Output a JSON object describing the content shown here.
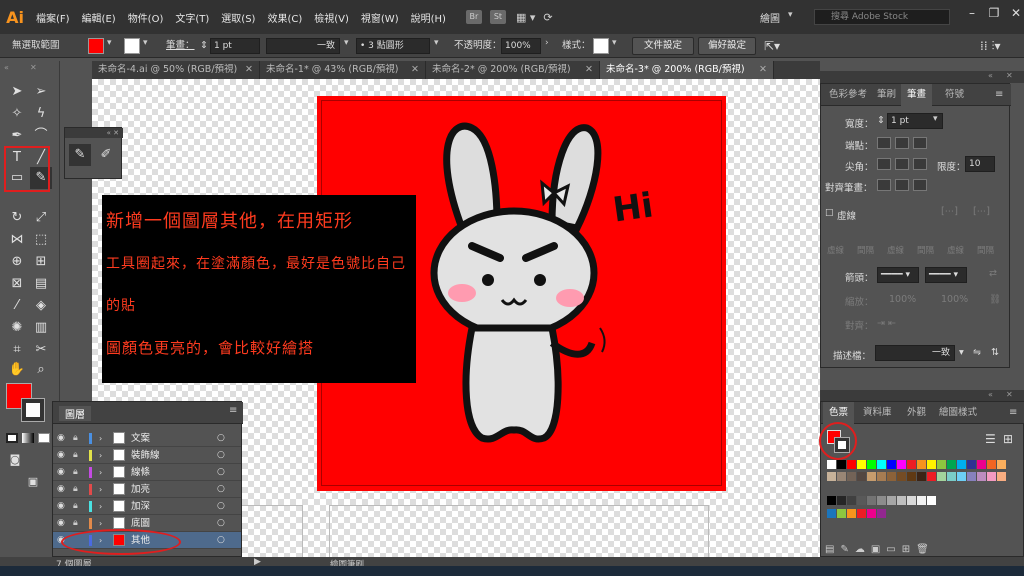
{
  "app": {
    "logo": "Ai",
    "menu": [
      "檔案(F)",
      "編輯(E)",
      "物件(O)",
      "文字(T)",
      "選取(S)",
      "效果(C)",
      "檢視(V)",
      "視窗(W)",
      "說明(H)"
    ],
    "badges": [
      "Br",
      "St"
    ],
    "workspace": "繪圖",
    "stock_search_placeholder": "搜尋 Adobe Stock"
  },
  "control": {
    "selection": "無選取範圍",
    "fill_color": "#ff0000",
    "stroke_label": "筆畫：",
    "stroke_weight": "1 pt",
    "stroke_style": "一致",
    "brush": "3 點圓形",
    "opacity_label": "不透明度：",
    "opacity": "100%",
    "style_label": "樣式：",
    "doc_settings": "文件設定",
    "preferences": "偏好設定"
  },
  "tabs": [
    {
      "label": "未命名-4.ai @ 50% (RGB/預視)",
      "active": false
    },
    {
      "label": "未命名-1* @ 43% (RGB/預視)",
      "active": false
    },
    {
      "label": "未命名-2* @ 200% (RGB/預視)",
      "active": false
    },
    {
      "label": "未命名-3* @ 200% (RGB/預視)",
      "active": true
    }
  ],
  "canvas": {
    "annotation_lines": [
      "新增一個圖層其他，在用矩形",
      "工具圈起來，在塗滿顏色，最好是色號比自己的貼",
      "圖顏色更亮的，會比較好繪搭"
    ],
    "artwork_text": "Hi",
    "artboard_color": "#ff0000"
  },
  "layers": {
    "title": "圖層",
    "count_label": "7 個圖層",
    "rows": [
      {
        "name": "文案",
        "color": "#4a90e2",
        "selected": false
      },
      {
        "name": "裝飾線",
        "color": "#e2e24a",
        "selected": false
      },
      {
        "name": "線條",
        "color": "#c44ae2",
        "selected": false
      },
      {
        "name": "加亮",
        "color": "#e24a4a",
        "selected": false
      },
      {
        "name": "加深",
        "color": "#4ae2e2",
        "selected": false
      },
      {
        "name": "底圖",
        "color": "#e28a4a",
        "selected": false
      },
      {
        "name": "其他",
        "color": "#4a6ae2",
        "selected": true
      }
    ]
  },
  "stroke_panel": {
    "tabs": [
      "色彩參考",
      "筆刷",
      "筆畫",
      "符號"
    ],
    "weight_label": "寬度：",
    "weight": "1 pt",
    "cap_label": "端點：",
    "corner_label": "尖角：",
    "limit_label": "限度：",
    "limit": "10",
    "align_label": "對齊筆畫：",
    "dashed_label": "虛線",
    "dash_labels": [
      "虛線",
      "間隔",
      "虛線",
      "間隔",
      "虛線",
      "間隔"
    ],
    "arrow_label": "箭頭：",
    "scale_label": "縮放：",
    "scale_a": "100%",
    "scale_b": "100%",
    "align_arrow_label": "對齊：",
    "profile_label": "描述檔：",
    "profile": "一致"
  },
  "swatch_panel": {
    "tabs": [
      "色票",
      "資料庫",
      "外觀",
      "繪圖樣式"
    ],
    "colors_row1": [
      "#ffffff",
      "#000000",
      "#ff0000",
      "#ffff00",
      "#00ff00",
      "#00ffff",
      "#0000ff",
      "#ff00ff",
      "#ed1c24",
      "#f7941d",
      "#fff200",
      "#8dc63f",
      "#00a651",
      "#00aeef",
      "#2e3192",
      "#ec008c",
      "#f26522",
      "#fbaf5d"
    ],
    "colors_row2": [
      "#c7b299",
      "#998675",
      "#736357",
      "#534741",
      "#c69c6d",
      "#a67c52",
      "#8c6239",
      "#754c24",
      "#603913",
      "#3c2415",
      "#ee1d24",
      "#a3d39c",
      "#7accc8",
      "#6dcff6",
      "#8781bd",
      "#bd8cbf",
      "#f49ac1",
      "#f9ad81"
    ],
    "colors_row3": [
      "#000000",
      "#262626",
      "#404040",
      "#595959",
      "#737373",
      "#8c8c8c",
      "#a6a6a6",
      "#bfbfbf",
      "#d9d9d9",
      "#f2f2f2",
      "#ffffff"
    ],
    "colors_row4": [
      "#1b75bc",
      "#8dc63f",
      "#f7941d",
      "#ed1c24",
      "#ec008c",
      "#92278f"
    ]
  },
  "status": {
    "tool": "繪圖筆刷"
  }
}
